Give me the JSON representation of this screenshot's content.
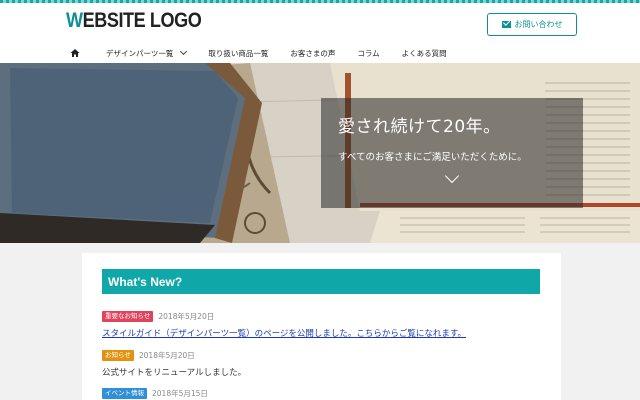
{
  "header": {
    "logo_accent": "W",
    "logo_rest": "EBSITE LOGO",
    "contact_label": "お問い合わせ",
    "contact_icon": "mail-icon"
  },
  "nav": {
    "items": [
      {
        "label": "",
        "icon": "home-icon"
      },
      {
        "label": "デザインパーツ一覧",
        "has_dropdown": true
      },
      {
        "label": "取り扱い商品一覧"
      },
      {
        "label": "お客さまの声"
      },
      {
        "label": "コラム"
      },
      {
        "label": "よくある質問"
      }
    ]
  },
  "hero": {
    "title": "愛され続けて20年。",
    "subtitle": "すべてのお客さまにご満足いただくために。",
    "arrow_icon": "chevron-down-icon"
  },
  "news": {
    "heading": "What's New?",
    "items": [
      {
        "badge": "重要なお知らせ",
        "badge_color": "#e0435a",
        "date": "2018年5月20日",
        "text": "スタイルガイド（デザインパーツ一覧）のページを公開しました。こちらからご覧になれます。",
        "is_link": true
      },
      {
        "badge": "お知らせ",
        "badge_color": "#e3920f",
        "date": "2018年5月20日",
        "text": "公式サイトをリニューアルしました。",
        "is_link": false
      },
      {
        "badge": "イベント情報",
        "badge_color": "#2f8fd8",
        "date": "2018年5月15日",
        "text": "",
        "is_link": false
      }
    ]
  },
  "colors": {
    "accent": "#0fa7a7",
    "link": "#1a3bb5"
  }
}
